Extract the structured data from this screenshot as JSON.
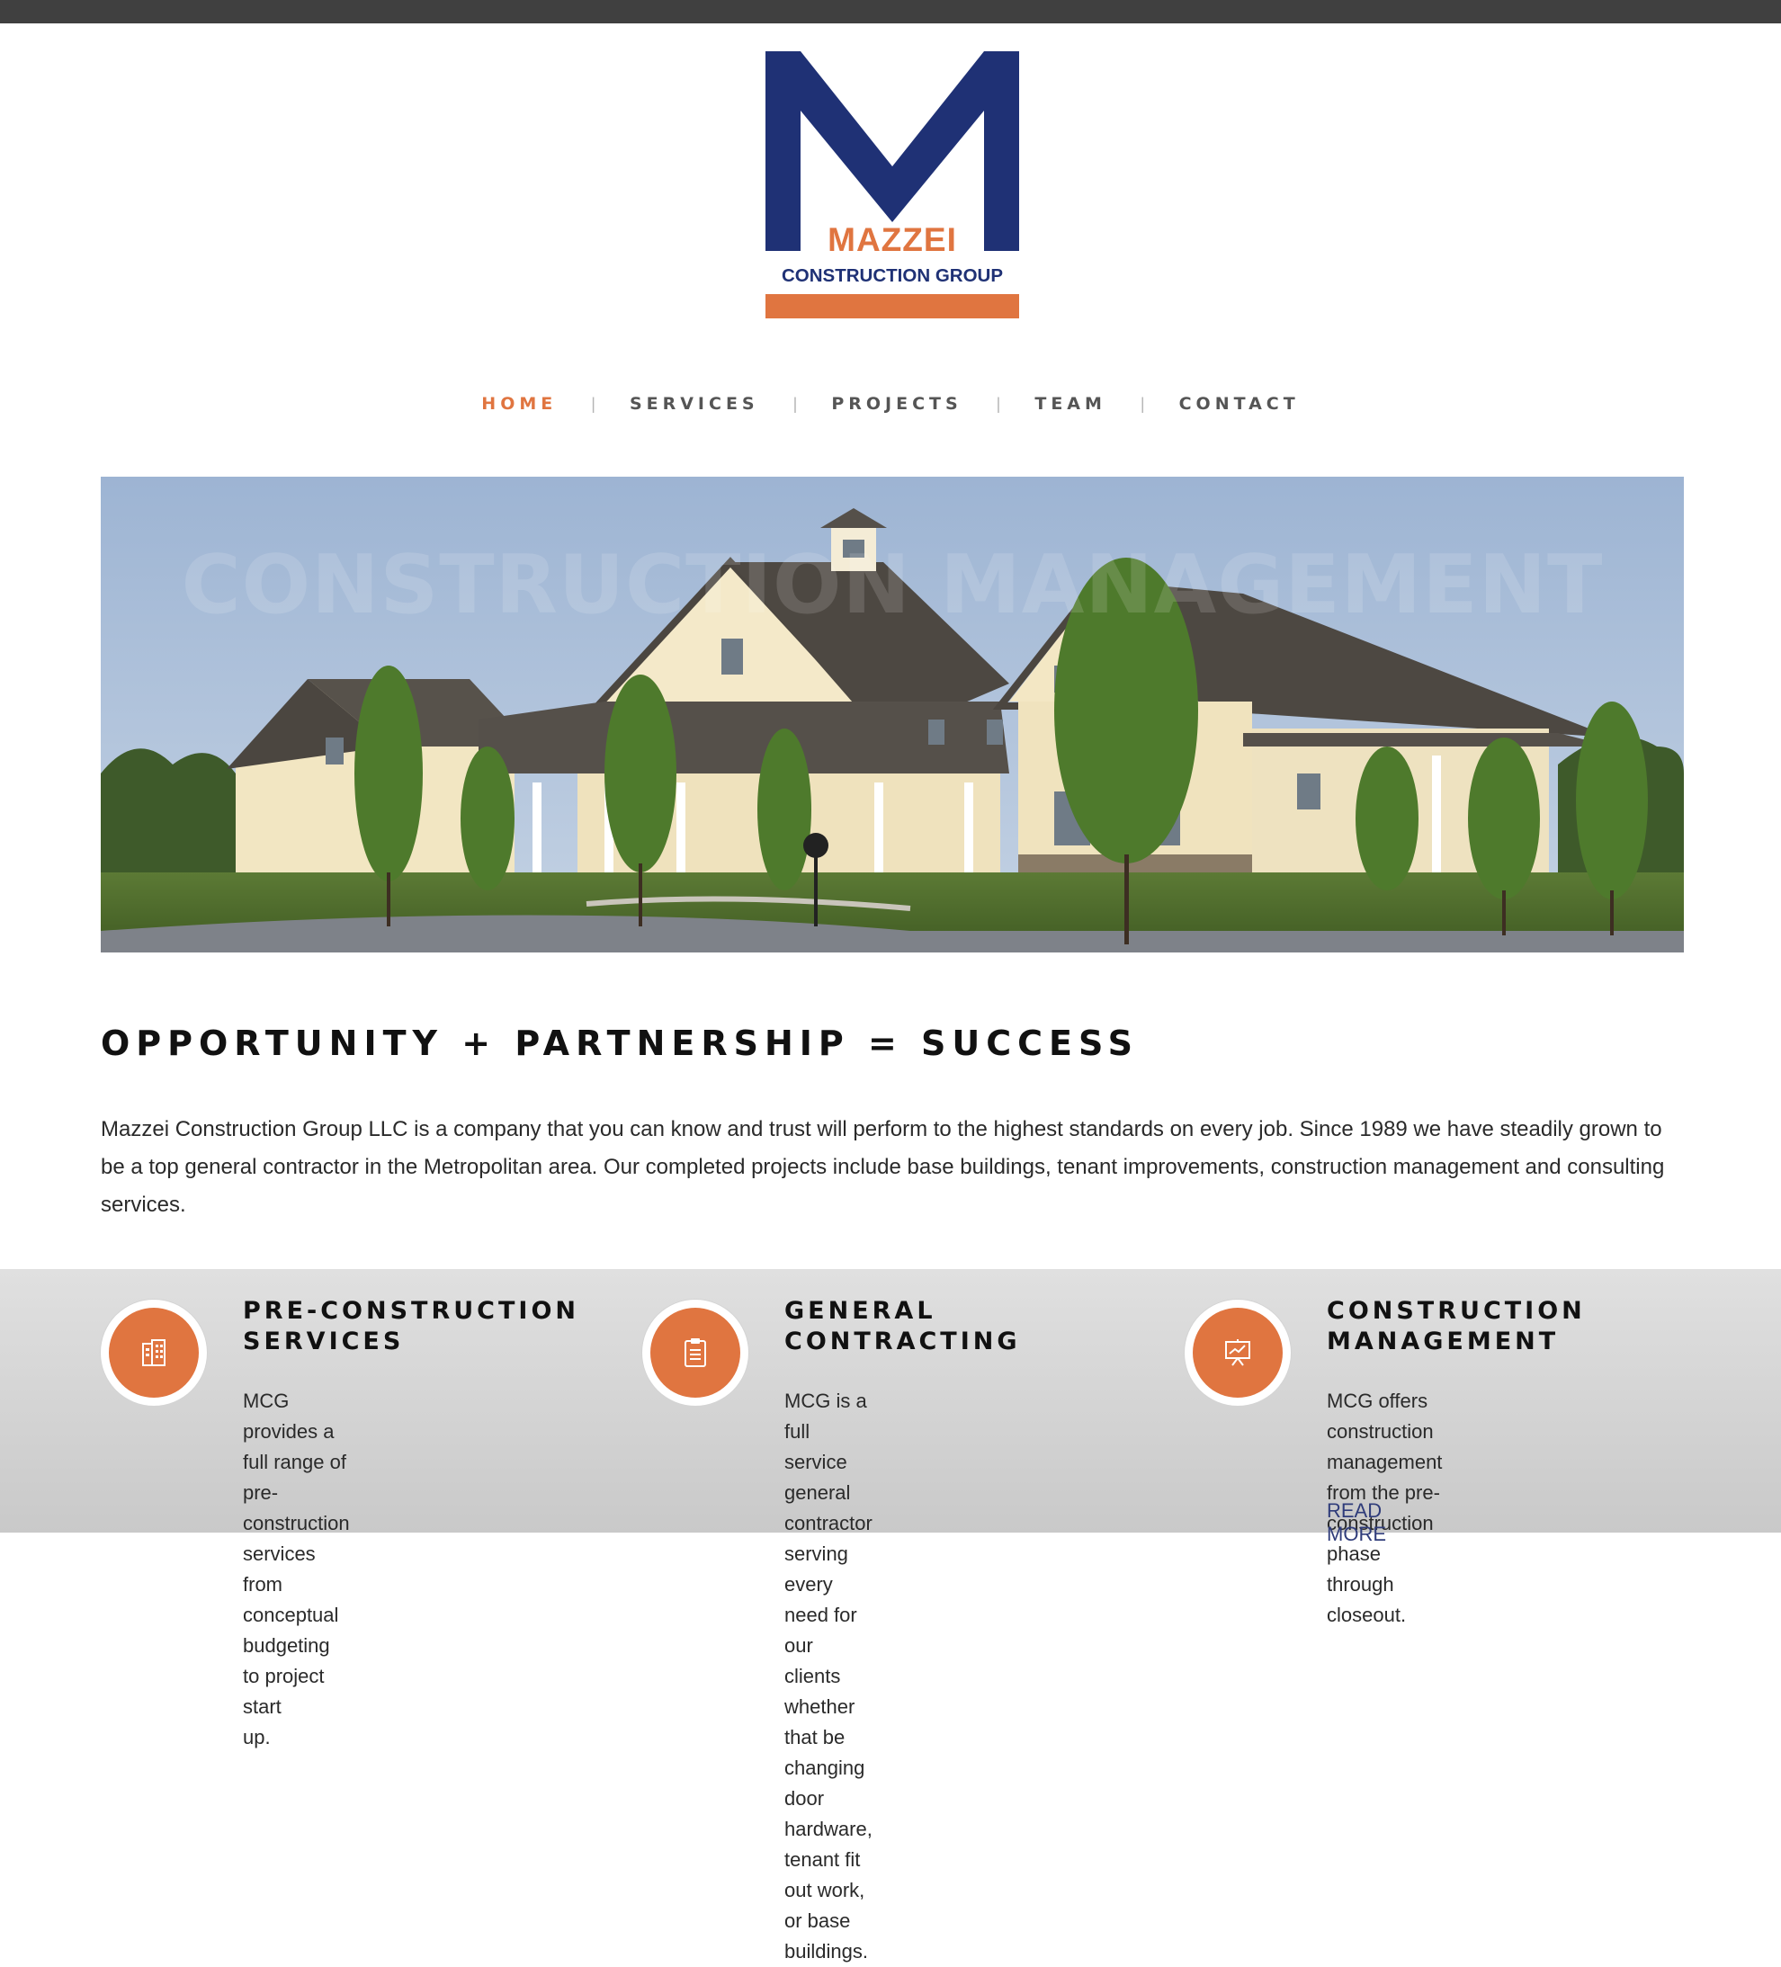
{
  "logo": {
    "brand_name": "MAZZEI",
    "brand_sub": "CONSTRUCTION GROUP"
  },
  "nav": {
    "items": [
      {
        "label": "HOME",
        "active": true
      },
      {
        "label": "SERVICES",
        "active": false
      },
      {
        "label": "PROJECTS",
        "active": false
      },
      {
        "label": "TEAM",
        "active": false
      },
      {
        "label": "CONTACT",
        "active": false
      }
    ],
    "separator": "|"
  },
  "hero": {
    "overlay_text": "CONSTRUCTION MANAGEMENT"
  },
  "headline": "OPPORTUNITY + PARTNERSHIP = SUCCESS",
  "intro": "Mazzei Construction Group LLC is a company that you can know and trust will perform to the highest standards on every job. Since 1989 we have steadily grown to be a top general contractor in the Metropolitan area. Our completed projects include base buildings, tenant improvements, construction management and consulting services.",
  "services": [
    {
      "icon": "building-icon",
      "title_line1": "PRE-CONSTRUCTION",
      "title_line2": "SERVICES",
      "lines": [
        "MCG provides a full range of pre-",
        "construction services from",
        "conceptual budgeting to project start",
        "up."
      ]
    },
    {
      "icon": "clipboard-icon",
      "title_line1": "GENERAL",
      "title_line2": "CONTRACTING",
      "lines": [
        "MCG is a full service general",
        "contractor serving every need for our",
        "clients whether that be changing door",
        "hardware, tenant fit out work, or base",
        "buildings."
      ]
    },
    {
      "icon": "presentation-chart-icon",
      "title_line1": "CONSTRUCTION",
      "title_line2": "MANAGEMENT",
      "lines": [
        "MCG offers construction management",
        "from the pre-construction phase",
        "through closeout."
      ],
      "link": "READ MORE"
    }
  ],
  "colors": {
    "accent": "#e07540",
    "brand_blue": "#1f3175",
    "topbar": "#404040",
    "nav_text": "#555555"
  }
}
